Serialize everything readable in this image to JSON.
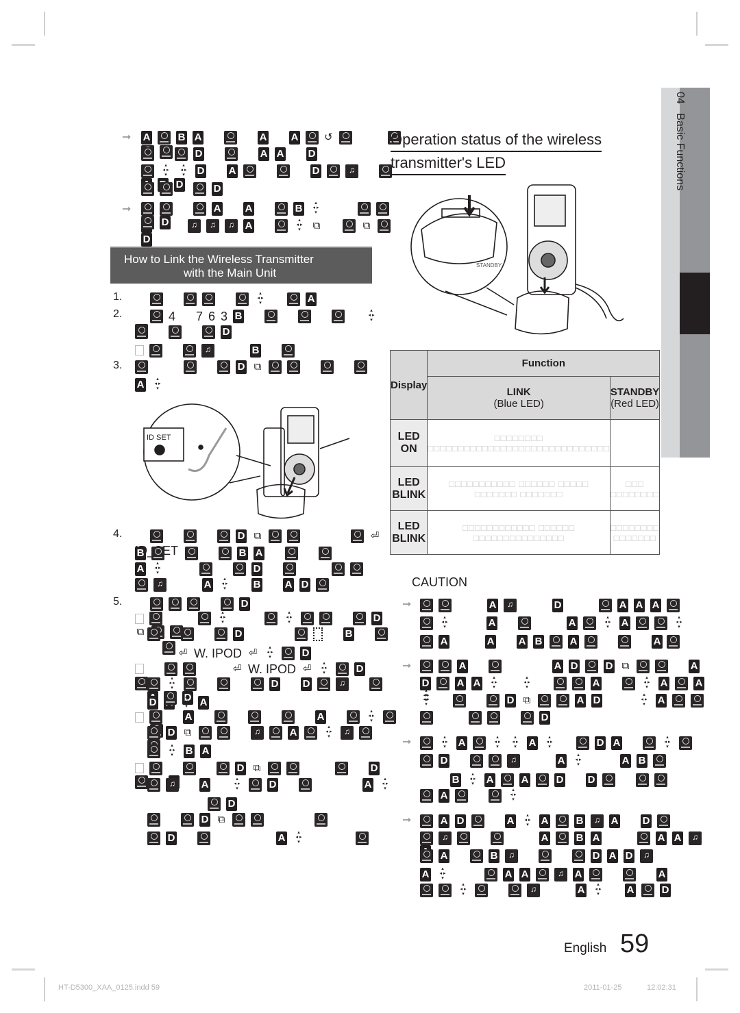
{
  "page": {
    "language_label": "English",
    "page_number": "59",
    "chapter_tab": {
      "number": "04",
      "title": "Basic Functions"
    },
    "footer": {
      "file": "HT-D5300_XAA_0125.indd   59",
      "date": "2011-01-25",
      "time": "12:02:31"
    }
  },
  "notes_top": [
    {
      "lines": [
        [
          "A",
          "disc",
          "B",
          "A",
          "sp",
          "disc",
          "sp",
          "A",
          "sp",
          "A",
          "disc",
          "refresh",
          "disc",
          "sp",
          "sp",
          "disc",
          "disc",
          "disc"
        ],
        [
          "disc",
          "sp",
          "disc",
          "D",
          "sp",
          "disc",
          "sp",
          "A",
          "A",
          "sp",
          "D"
        ],
        [
          "disc",
          "arrows",
          "arrows",
          "D",
          "sp",
          "A",
          "disc",
          "sp",
          "disc",
          "sp",
          "D",
          "disc",
          "note",
          "sp",
          "disc",
          "A",
          "D",
          "D"
        ],
        [
          "disc",
          "disc",
          "sp",
          "disc",
          "D"
        ]
      ]
    },
    {
      "lines": [
        [
          "disc",
          "disc",
          "sp",
          "disc",
          "A",
          "sp",
          "A",
          "sp",
          "disc",
          "B",
          "arrows",
          "sp",
          "sp",
          "disc",
          "disc",
          "sp",
          "disc",
          "D"
        ],
        [
          "A",
          "sp",
          "sp",
          "note",
          "note",
          "note",
          "A",
          "sp",
          "disc",
          "arrows",
          "screen",
          "sp",
          "disc",
          "screen",
          "disc",
          "D"
        ]
      ]
    }
  ],
  "link_section": {
    "title_line1": "How to Link the Wireless Transmitter",
    "title_line2": "with the Main Unit",
    "steps": [
      {
        "num": "1.",
        "lines": [
          [
            "sp",
            "disc",
            "sp",
            "disc",
            "disc",
            "sp",
            "disc",
            "arrows",
            "sp",
            "disc",
            "A"
          ]
        ]
      },
      {
        "num": "2.",
        "lines": [
          [
            "sp",
            "disc",
            "n4",
            "sp",
            "n7",
            "n6",
            "n3",
            "B",
            "sp",
            "disc",
            "sp",
            "disc",
            "sp",
            "disc",
            "sp",
            "arrows",
            "disc"
          ],
          [
            "disc",
            "sp",
            "disc",
            "sp",
            "disc",
            "D"
          ],
          [
            "box",
            "disc",
            "sp",
            "disc",
            "note",
            "sp",
            "sp",
            "B",
            "sp",
            "disc"
          ]
        ]
      },
      {
        "num": "3.",
        "lines": [
          [
            "disc",
            "sp",
            "sp",
            "disc",
            "sp",
            "disc",
            "D",
            "screen",
            "disc",
            "disc",
            "sp",
            "disc",
            "sp",
            "disc"
          ],
          [
            "A",
            "arrows"
          ]
        ]
      },
      {
        "num": "4.",
        "lines": [
          [
            "sp",
            "disc",
            "sp",
            "disc",
            "sp",
            "disc",
            "D",
            "screen",
            "disc",
            "disc",
            "sp",
            "sp",
            "sp",
            "disc",
            "enter",
            "t_ID_SET"
          ],
          [
            "B",
            "disc",
            "sp",
            "disc",
            "sp",
            "disc",
            "B",
            "A",
            "sp",
            "disc",
            "sp",
            "disc"
          ],
          [
            "A",
            "arrows",
            "sp",
            "sp",
            "disc",
            "sp",
            "disc",
            "D",
            "sp",
            "disc",
            "sp",
            "sp",
            "disc",
            "disc"
          ],
          [
            "disc",
            "note",
            "sp",
            "sp",
            "A",
            "arrows",
            "sp",
            "B",
            "sp",
            "A",
            "D",
            "disc"
          ]
        ]
      },
      {
        "num": "5.",
        "lines": [
          [
            "sp",
            "disc",
            "disc",
            "disc",
            "sp",
            "disc",
            "D"
          ]
        ]
      }
    ],
    "sub_bullets": [
      {
        "lines": [
          [
            "box",
            "disc",
            "sp",
            "sp",
            "disc",
            "arrows",
            "sp",
            "sp",
            "disc",
            "arrows",
            "disc",
            "disc",
            "sp",
            "disc",
            "D",
            "screen",
            "disc",
            "disc"
          ],
          [
            "disc",
            "sp",
            "disc",
            "sp",
            "disc",
            "D",
            "sp",
            "sp",
            "sp",
            "disc",
            "dotted",
            "sp",
            "B",
            "sp",
            "disc",
            "sp",
            "disc"
          ],
          [
            "sp",
            "sp",
            "enter",
            "t_W. IPOD",
            "enter",
            "arrows",
            "disc",
            "D"
          ]
        ]
      },
      {
        "lines": [
          [
            "box",
            "sp",
            "disc",
            "disc",
            "sp",
            "sp",
            "enter",
            "t_W. IPOD",
            "enter",
            "arrows",
            "disc",
            "D",
            "sp",
            "sp",
            "disc"
          ],
          [
            "disc",
            "arrows",
            "disc",
            "sp",
            "disc",
            "sp",
            "disc",
            "D",
            "sp",
            "D",
            "disc",
            "note",
            "sp",
            "disc",
            "A",
            "disc",
            "D"
          ],
          [
            "D",
            "A",
            "arrows",
            "A"
          ]
        ]
      },
      {
        "lines": [
          [
            "box",
            "disc",
            "sp",
            "A",
            "sp",
            "disc",
            "sp",
            "disc",
            "sp",
            "disc",
            "sp",
            "A",
            "sp",
            "disc",
            "arrows",
            "disc",
            "sp",
            "disc"
          ],
          [
            "disc",
            "D",
            "screen",
            "disc",
            "disc",
            "sp",
            "note",
            "disc",
            "A",
            "disc",
            "arrows",
            "note",
            "disc",
            "sp",
            "disc"
          ],
          [
            "disc",
            "arrows",
            "B",
            "A"
          ]
        ]
      },
      {
        "lines": [
          [
            "box",
            "disc",
            "sp",
            "disc",
            "sp",
            "disc",
            "D",
            "screen",
            "disc",
            "disc",
            "sp",
            "sp",
            "disc",
            "sp",
            "D",
            "disc",
            "sp",
            "A"
          ],
          [
            "disc",
            "note",
            "sp",
            "A",
            "sp",
            "arrows",
            "disc",
            "D",
            "sp",
            "disc",
            "sp",
            "sp",
            "sp",
            "A",
            "arrows"
          ],
          [
            "sp",
            "sp",
            "sp",
            "sp",
            "disc",
            "D"
          ],
          [
            "disc",
            "sp",
            "disc",
            "D",
            "screen",
            "disc",
            "disc",
            "sp",
            "sp",
            "sp",
            "disc"
          ],
          [
            "disc",
            "D",
            "sp",
            "disc",
            "sp",
            "sp",
            "sp",
            "sp",
            "A",
            "arrows",
            "sp",
            "sp",
            "sp",
            "disc"
          ]
        ]
      }
    ]
  },
  "led_status": {
    "title_line1": "Operation status of the wireless",
    "title_line2": "transmitter's LED",
    "table": {
      "header_display": "Display",
      "header_function": "Function",
      "col_link": "LINK",
      "col_link_sub": "(Blue LED)",
      "col_standby": "STANDBY",
      "col_standby_sub": "(Red LED)",
      "rows": [
        {
          "display": "LED ON",
          "link": "□□□□□□□□ □□□□□□□□□□□□□□□□□□□□□□□□□□□□□□",
          "standby": ""
        },
        {
          "display": "LED  BLINK",
          "link": "□□□□□□□□□□□ □□□□□□ □□□□□ □□□□□□□ □□□□□□□",
          "standby": "□□□ □□□□□□□□"
        },
        {
          "display": "LED  BLINK",
          "link": "□□□□□□□□□□□□ □□□□□□ □□□□□□□□□□□□□□□",
          "standby": "□□□□□□□□ □□□□□□□"
        }
      ]
    }
  },
  "caution": {
    "heading": "CAUTION",
    "notes": [
      {
        "lines": [
          [
            "disc",
            "disc",
            "sp",
            "sp",
            "A",
            "note",
            "sp",
            "sp",
            "D",
            "sp",
            "sp",
            "disc",
            "A",
            "A",
            "A",
            "disc"
          ],
          [
            "disc",
            "arrows",
            "sp",
            "sp",
            "A",
            "sp",
            "disc",
            "sp",
            "sp",
            "A",
            "disc",
            "arrows",
            "A",
            "disc",
            "disc",
            "arrows"
          ],
          [
            "disc",
            "A",
            "sp",
            "sp",
            "A",
            "sp",
            "A",
            "B",
            "disc",
            "A",
            "disc",
            "sp",
            "disc",
            "sp",
            "A"
          ],
          [
            "disc"
          ]
        ]
      },
      {
        "lines": [
          [
            "disc",
            "disc",
            "A",
            "sp",
            "disc",
            "sp",
            "sp",
            "sp",
            "A",
            "D",
            "disc",
            "D",
            "screen",
            "disc",
            "disc",
            "sp",
            "A"
          ],
          [
            "D",
            "disc",
            "A",
            "A",
            "arrows",
            "sp",
            "arrows",
            "sp",
            "disc",
            "disc",
            "A",
            "sp",
            "disc",
            "arrows",
            "A",
            "disc",
            "A",
            "arrows"
          ],
          [
            "arrows",
            "sp",
            "disc",
            "sp",
            "disc",
            "D",
            "screen",
            "disc",
            "disc",
            "A",
            "D",
            "sp",
            "sp",
            "arrows",
            "A",
            "disc",
            "disc"
          ],
          [
            "disc",
            "sp",
            "sp",
            "disc",
            "disc",
            "sp",
            "disc",
            "D"
          ]
        ]
      },
      {
        "lines": [
          [
            "disc",
            "arrows",
            "A",
            "disc",
            "arrows",
            "arrows",
            "A",
            "arrows",
            "sp",
            "disc",
            "D",
            "A",
            "sp",
            "disc",
            "arrows",
            "disc"
          ],
          [
            "disc",
            "D",
            "sp",
            "disc",
            "disc",
            "note",
            "sp",
            "sp",
            "A",
            "arrows",
            "sp",
            "sp",
            "A",
            "B",
            "disc"
          ],
          [
            "sp",
            "sp",
            "B",
            "arrows",
            "A",
            "disc",
            "A",
            "disc",
            "D",
            "sp",
            "D",
            "disc",
            "sp",
            "disc",
            "disc"
          ],
          [
            "disc",
            "A",
            "disc",
            "sp",
            "disc",
            "arrows"
          ]
        ]
      },
      {
        "lines": [
          [
            "disc",
            "A",
            "D",
            "disc",
            "sp",
            "A",
            "arrows",
            "A",
            "disc",
            "B",
            "note",
            "A",
            "sp",
            "D",
            "disc"
          ],
          [
            "disc",
            "note",
            "disc",
            "sp",
            "disc",
            "sp",
            "sp",
            "A",
            "disc",
            "B",
            "A",
            "sp",
            "sp",
            "disc",
            "A",
            "A",
            "note",
            "A"
          ],
          [
            "disc",
            "A",
            "sp",
            "disc",
            "B",
            "note",
            "sp",
            "disc",
            "sp",
            "disc",
            "D",
            "A",
            "D",
            "note"
          ],
          [
            "A",
            "arrows",
            "sp",
            "sp",
            "disc",
            "A",
            "A",
            "disc",
            "note",
            "A",
            "disc",
            "sp",
            "disc",
            "sp",
            "A"
          ],
          [
            "disc",
            "disc",
            "arrows",
            "disc",
            "sp",
            "disc",
            "note",
            "sp",
            "sp",
            "A",
            "arrows",
            "sp",
            "A",
            "disc",
            "D"
          ]
        ]
      }
    ]
  },
  "figures": {
    "fig_top_label": "STANDBY",
    "fig_idset_label": "ID SET"
  }
}
